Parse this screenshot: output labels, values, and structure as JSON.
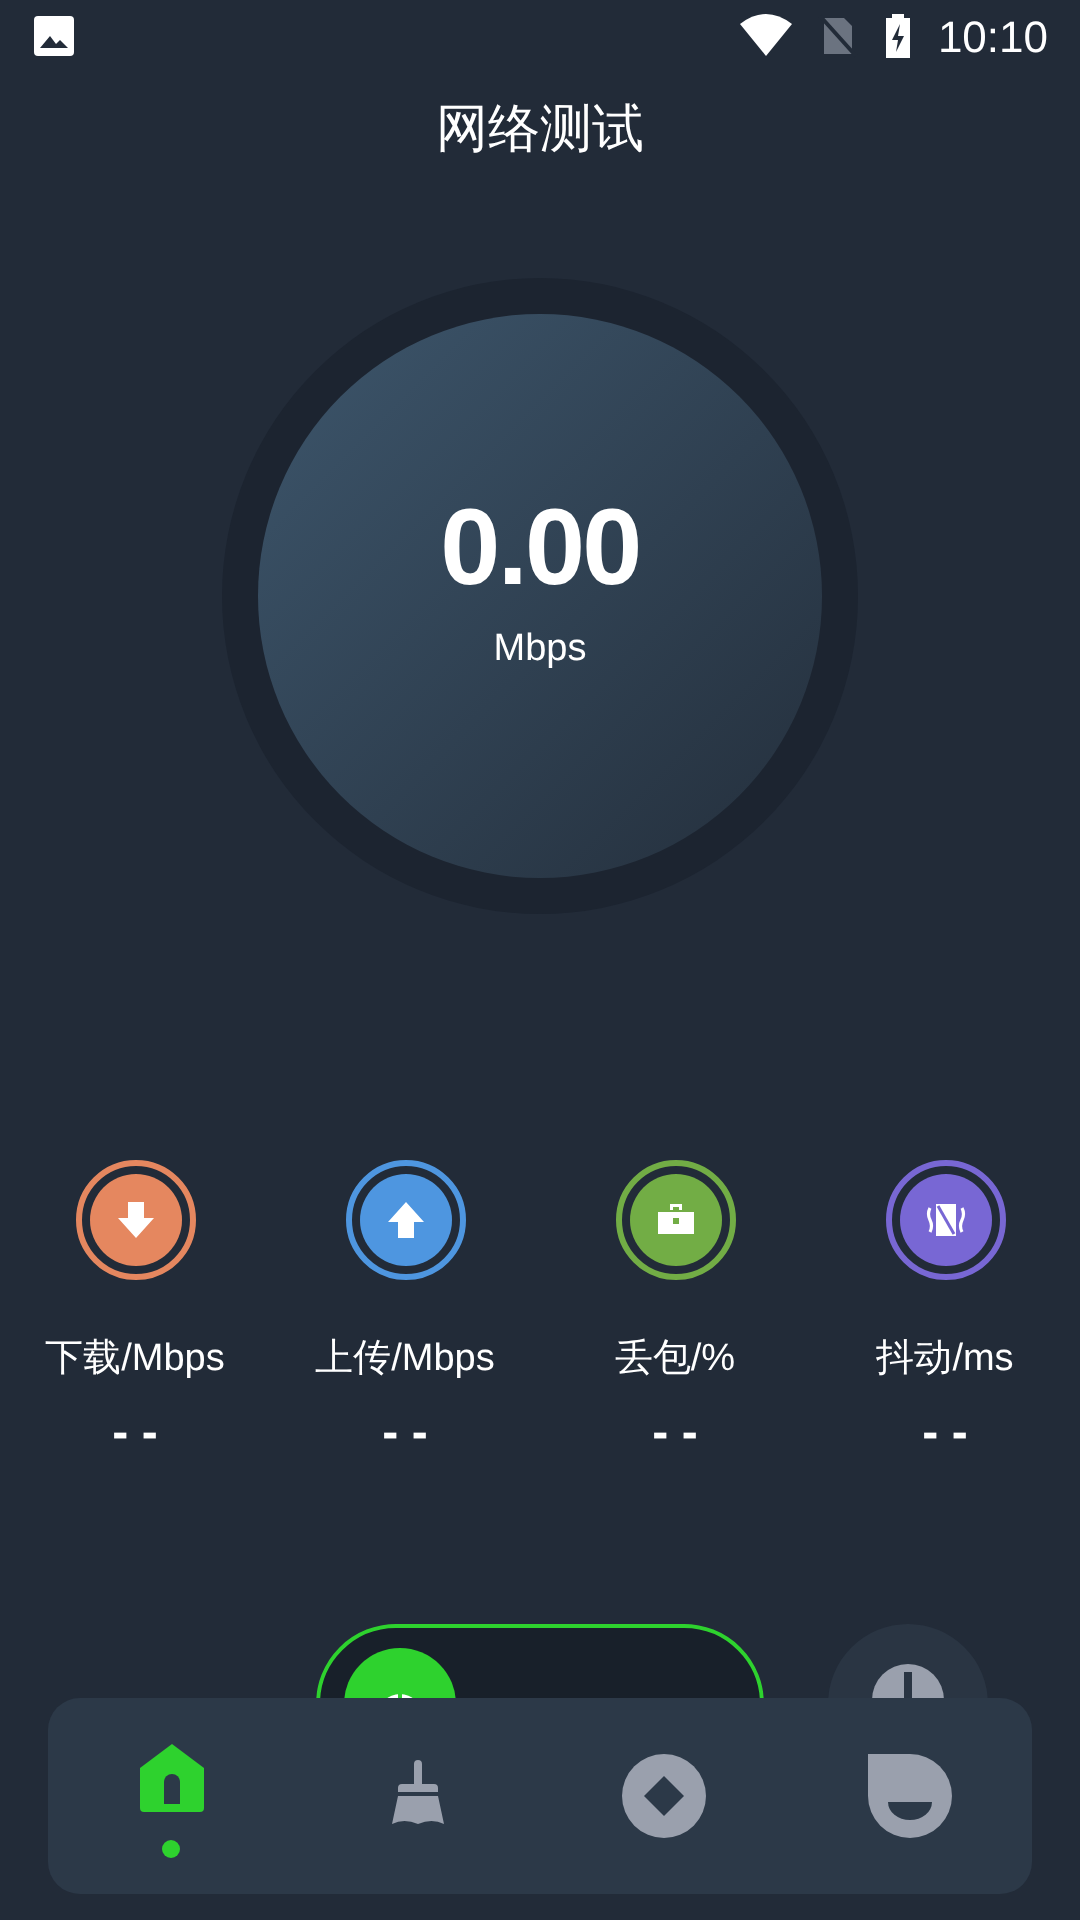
{
  "status_bar": {
    "time": "10:10"
  },
  "title": "网络测试",
  "gauge": {
    "value": "0.00",
    "unit": "Mbps"
  },
  "stats": [
    {
      "kind": "download",
      "label": "下载/Mbps",
      "value": "- -",
      "color": "#e5875f"
    },
    {
      "kind": "upload",
      "label": "上传/Mbps",
      "value": "- -",
      "color": "#4e96e0"
    },
    {
      "kind": "loss",
      "label": "丢包/%",
      "value": "- -",
      "color": "#72ad45"
    },
    {
      "kind": "jitter",
      "label": "抖动/ms",
      "value": "- -",
      "color": "#7867d4"
    }
  ],
  "nav": [
    {
      "kind": "home",
      "selected": true
    },
    {
      "kind": "clean",
      "selected": false
    },
    {
      "kind": "diamond",
      "selected": false
    },
    {
      "kind": "face",
      "selected": false
    }
  ]
}
